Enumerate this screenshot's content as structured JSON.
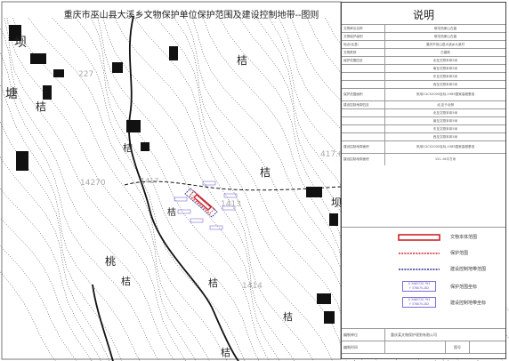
{
  "map": {
    "title": "重庆市巫山县大溪乡文物保护单位保护范围及建设控制地带--图则",
    "place_labels": [
      "坝",
      "塘",
      "桔",
      "桔",
      "桔",
      "桔",
      "桔",
      "桃",
      "桔",
      "桔",
      "桔",
      "桔",
      "坝"
    ],
    "elevation_labels": [
      "227",
      "14270",
      "1417",
      "1413",
      "417.6",
      "1414"
    ],
    "colors": {
      "heritage_border": "#d0232a",
      "protection_line": "#d0232a",
      "control_line": "#2e3193",
      "coord_box": "#7b6fd8"
    }
  },
  "legend": {
    "title": "说明",
    "info_rows": [
      {
        "label": "文物单位名称",
        "value": "故宅西家山古墓"
      },
      {
        "label": "文物保护级别",
        "value": "故宅西家山古墓"
      },
      {
        "label": "地点(区县)",
        "value": "重庆市巫山县大溪乡大溪村"
      },
      {
        "label": "文物类别",
        "value": "古建筑"
      },
      {
        "label": "保护范围四至",
        "value": "北至文物本体5米"
      },
      {
        "label": "",
        "value": "南至文物本体5米"
      },
      {
        "label": "",
        "value": "东至文物本体5米"
      },
      {
        "label": "",
        "value": "西至文物本体5米"
      },
      {
        "label": "保护范围面积",
        "value": "采用CGCS2000坐标,1985国家高程基准"
      },
      {
        "label": "建设控制地带四至",
        "value": "北,至于北侧"
      },
      {
        "label": "",
        "value": "北至文物本体5米"
      },
      {
        "label": "",
        "value": "南至文物本体5米"
      },
      {
        "label": "",
        "value": "东至文物本体5米"
      },
      {
        "label": "",
        "value": "西至文物本体5米"
      },
      {
        "label": "建设控制地带面积",
        "value": "采用CGCS2000坐标,1985国家高程基准"
      },
      {
        "label": "建设控制地带面积",
        "value": "151.16平方米"
      }
    ],
    "legend_items": [
      {
        "label": "文物本体范围"
      },
      {
        "label": "保护范围"
      },
      {
        "label": "建设控制地带范围"
      },
      {
        "label": "保护范围坐标",
        "coord_x": "X 3465720.794",
        "coord_y": "Y 378070.282"
      },
      {
        "label": "建设控制地带坐标",
        "coord_x": "X 3465720.794",
        "coord_y": "Y 378070.282"
      }
    ],
    "footer": {
      "unit_label": "编制单位",
      "unit_value": "重庆某文物保护规划有限公司",
      "date_label": "编制时间",
      "sheet_label": "图号"
    }
  }
}
